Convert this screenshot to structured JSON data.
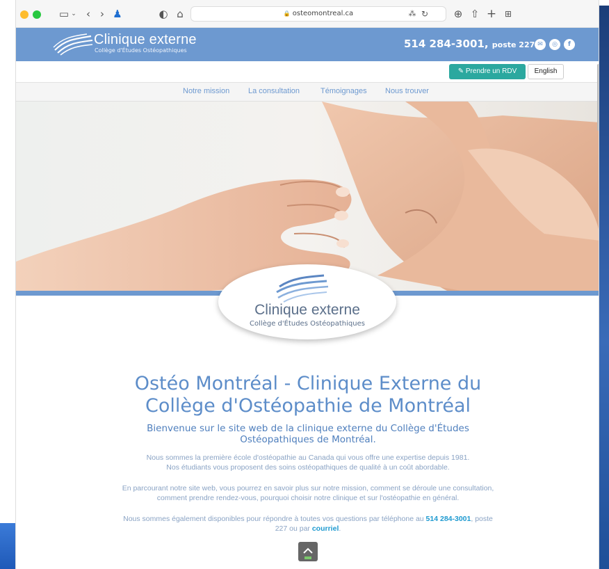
{
  "browser": {
    "url": "osteomontreal.ca"
  },
  "header": {
    "logo_title": "Clinique externe",
    "logo_subtitle": "Collège d'Études Ostéopathiques",
    "phone": "514 284-3001,",
    "poste": "poste 227"
  },
  "actions": {
    "rdv_label": "Prendre un RDV",
    "lang_label": "English"
  },
  "nav": {
    "items": [
      "Notre mission",
      "La consultation",
      "Témoignages",
      "Nous trouver"
    ]
  },
  "badge": {
    "title": "Clinique externe",
    "subtitle": "Collège d'Études Ostéopathiques"
  },
  "main": {
    "title": "Ostéo Montréal - Clinique Externe du Collège d'Ostéopathie de Montréal",
    "subtitle": "Bienvenue sur le site web de la clinique externe du Collège d'Études Ostéopathiques de Montréal.",
    "p1_line1": "Nous sommes la première école d'ostéopathie au Canada qui vous offre une expertise depuis 1981.",
    "p1_line2": "Nos étudiants vous proposent des soins ostéopathiques de qualité à un coût abordable.",
    "p2_line1": "En parcourant notre site web, vous pourrez en savoir plus sur notre mission, comment se déroule une consultation,",
    "p2_line2": "comment prendre rendez-vous, pourquoi choisir notre clinique et sur l'ostéopathie en général.",
    "p3_a": "Nous sommes également disponibles pour répondre à toutes vos questions par téléphone au ",
    "p3_phone": "514 284-3001",
    "p3_b": ", poste",
    "p3_c": "227 ou par ",
    "p3_email": "courriel",
    "p3_d": "."
  },
  "colors": {
    "brand_blue": "#6d99d0",
    "teal": "#2ba89f",
    "link": "#1e9ad0"
  }
}
